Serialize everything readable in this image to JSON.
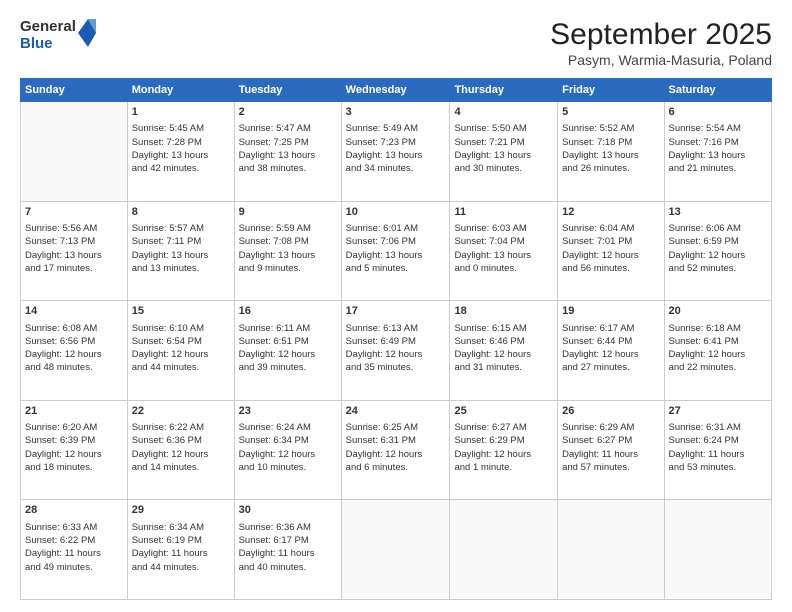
{
  "logo": {
    "general": "General",
    "blue": "Blue"
  },
  "title": "September 2025",
  "subtitle": "Pasym, Warmia-Masuria, Poland",
  "days_of_week": [
    "Sunday",
    "Monday",
    "Tuesday",
    "Wednesday",
    "Thursday",
    "Friday",
    "Saturday"
  ],
  "weeks": [
    [
      {
        "day": "",
        "info": ""
      },
      {
        "day": "1",
        "info": "Sunrise: 5:45 AM\nSunset: 7:28 PM\nDaylight: 13 hours\nand 42 minutes."
      },
      {
        "day": "2",
        "info": "Sunrise: 5:47 AM\nSunset: 7:25 PM\nDaylight: 13 hours\nand 38 minutes."
      },
      {
        "day": "3",
        "info": "Sunrise: 5:49 AM\nSunset: 7:23 PM\nDaylight: 13 hours\nand 34 minutes."
      },
      {
        "day": "4",
        "info": "Sunrise: 5:50 AM\nSunset: 7:21 PM\nDaylight: 13 hours\nand 30 minutes."
      },
      {
        "day": "5",
        "info": "Sunrise: 5:52 AM\nSunset: 7:18 PM\nDaylight: 13 hours\nand 26 minutes."
      },
      {
        "day": "6",
        "info": "Sunrise: 5:54 AM\nSunset: 7:16 PM\nDaylight: 13 hours\nand 21 minutes."
      }
    ],
    [
      {
        "day": "7",
        "info": "Sunrise: 5:56 AM\nSunset: 7:13 PM\nDaylight: 13 hours\nand 17 minutes."
      },
      {
        "day": "8",
        "info": "Sunrise: 5:57 AM\nSunset: 7:11 PM\nDaylight: 13 hours\nand 13 minutes."
      },
      {
        "day": "9",
        "info": "Sunrise: 5:59 AM\nSunset: 7:08 PM\nDaylight: 13 hours\nand 9 minutes."
      },
      {
        "day": "10",
        "info": "Sunrise: 6:01 AM\nSunset: 7:06 PM\nDaylight: 13 hours\nand 5 minutes."
      },
      {
        "day": "11",
        "info": "Sunrise: 6:03 AM\nSunset: 7:04 PM\nDaylight: 13 hours\nand 0 minutes."
      },
      {
        "day": "12",
        "info": "Sunrise: 6:04 AM\nSunset: 7:01 PM\nDaylight: 12 hours\nand 56 minutes."
      },
      {
        "day": "13",
        "info": "Sunrise: 6:06 AM\nSunset: 6:59 PM\nDaylight: 12 hours\nand 52 minutes."
      }
    ],
    [
      {
        "day": "14",
        "info": "Sunrise: 6:08 AM\nSunset: 6:56 PM\nDaylight: 12 hours\nand 48 minutes."
      },
      {
        "day": "15",
        "info": "Sunrise: 6:10 AM\nSunset: 6:54 PM\nDaylight: 12 hours\nand 44 minutes."
      },
      {
        "day": "16",
        "info": "Sunrise: 6:11 AM\nSunset: 6:51 PM\nDaylight: 12 hours\nand 39 minutes."
      },
      {
        "day": "17",
        "info": "Sunrise: 6:13 AM\nSunset: 6:49 PM\nDaylight: 12 hours\nand 35 minutes."
      },
      {
        "day": "18",
        "info": "Sunrise: 6:15 AM\nSunset: 6:46 PM\nDaylight: 12 hours\nand 31 minutes."
      },
      {
        "day": "19",
        "info": "Sunrise: 6:17 AM\nSunset: 6:44 PM\nDaylight: 12 hours\nand 27 minutes."
      },
      {
        "day": "20",
        "info": "Sunrise: 6:18 AM\nSunset: 6:41 PM\nDaylight: 12 hours\nand 22 minutes."
      }
    ],
    [
      {
        "day": "21",
        "info": "Sunrise: 6:20 AM\nSunset: 6:39 PM\nDaylight: 12 hours\nand 18 minutes."
      },
      {
        "day": "22",
        "info": "Sunrise: 6:22 AM\nSunset: 6:36 PM\nDaylight: 12 hours\nand 14 minutes."
      },
      {
        "day": "23",
        "info": "Sunrise: 6:24 AM\nSunset: 6:34 PM\nDaylight: 12 hours\nand 10 minutes."
      },
      {
        "day": "24",
        "info": "Sunrise: 6:25 AM\nSunset: 6:31 PM\nDaylight: 12 hours\nand 6 minutes."
      },
      {
        "day": "25",
        "info": "Sunrise: 6:27 AM\nSunset: 6:29 PM\nDaylight: 12 hours\nand 1 minute."
      },
      {
        "day": "26",
        "info": "Sunrise: 6:29 AM\nSunset: 6:27 PM\nDaylight: 11 hours\nand 57 minutes."
      },
      {
        "day": "27",
        "info": "Sunrise: 6:31 AM\nSunset: 6:24 PM\nDaylight: 11 hours\nand 53 minutes."
      }
    ],
    [
      {
        "day": "28",
        "info": "Sunrise: 6:33 AM\nSunset: 6:22 PM\nDaylight: 11 hours\nand 49 minutes."
      },
      {
        "day": "29",
        "info": "Sunrise: 6:34 AM\nSunset: 6:19 PM\nDaylight: 11 hours\nand 44 minutes."
      },
      {
        "day": "30",
        "info": "Sunrise: 6:36 AM\nSunset: 6:17 PM\nDaylight: 11 hours\nand 40 minutes."
      },
      {
        "day": "",
        "info": ""
      },
      {
        "day": "",
        "info": ""
      },
      {
        "day": "",
        "info": ""
      },
      {
        "day": "",
        "info": ""
      }
    ]
  ]
}
